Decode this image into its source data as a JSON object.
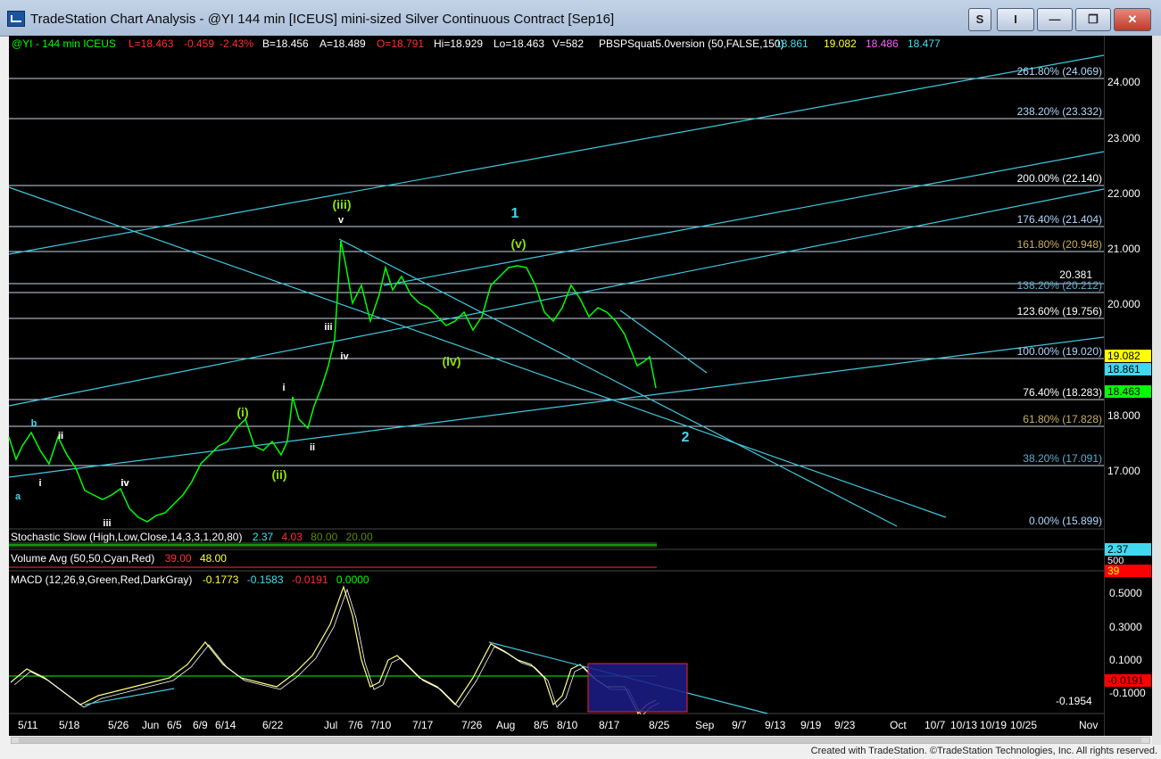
{
  "window": {
    "title": "TradeStation Chart Analysis - @YI 144 min [ICEUS] mini-sized Silver Continuous Contract [Sep16]",
    "buttons": {
      "s": "S",
      "i": "I",
      "min": "—",
      "max": "❐",
      "close": "✕"
    }
  },
  "header": [
    {
      "t": "@YI - 144 min  ICEUS",
      "c": "#00ff00"
    },
    {
      "t": "L=18.463",
      "c": "#ff3030"
    },
    {
      "t": "-0.459",
      "c": "#ff3030"
    },
    {
      "t": "-2.43%",
      "c": "#ff3030"
    },
    {
      "t": "B=18.456",
      "c": "#ffffff"
    },
    {
      "t": "A=18.489",
      "c": "#ffffff"
    },
    {
      "t": "O=18.791",
      "c": "#ff3030"
    },
    {
      "t": "Hi=18.929",
      "c": "#ffffff"
    },
    {
      "t": "Lo=18.463",
      "c": "#ffffff"
    },
    {
      "t": "V=582",
      "c": "#ffffff"
    },
    {
      "t": "PBSPSquat5.0version (50,FALSE,150)",
      "c": "#ffffff"
    },
    {
      "t": "18.861",
      "c": "#40e0f0"
    },
    {
      "t": "19.082",
      "c": "#ffff40"
    },
    {
      "t": "18.486",
      "c": "#ff60ff"
    },
    {
      "t": "18.477",
      "c": "#40e0f0"
    }
  ],
  "price_axis": [
    "24.000",
    "23.000",
    "22.000",
    "21.000",
    "20.000",
    "18.000",
    "17.000"
  ],
  "price_badges": [
    {
      "t": "19.082",
      "bg": "#ffff00",
      "fg": "#000000"
    },
    {
      "t": "18.861",
      "bg": "#40d8f0",
      "fg": "#000000"
    },
    {
      "t": "18.463",
      "bg": "#00ff00",
      "fg": "#000000"
    }
  ],
  "fib_levels": [
    {
      "label": "261.80% (24.069)",
      "color": "#b0d8ff"
    },
    {
      "label": "238.20% (23.332)",
      "color": "#b0d8ff"
    },
    {
      "label": "200.00% (22.140)",
      "color": "#ffffff"
    },
    {
      "label": "176.40% (21.404)",
      "color": "#b0d8ff"
    },
    {
      "label": "161.80% (20.948)",
      "color": "#c8b060"
    },
    {
      "label": "138.20% (20.212)",
      "color": "#5aaed0"
    },
    {
      "label": "123.60% (19.756)",
      "color": "#ffffff"
    },
    {
      "label": "100.00% (19.020)",
      "color": "#b0d8ff"
    },
    {
      "label": "76.40% (18.283)",
      "color": "#ffffff"
    },
    {
      "label": "61.80% (17.828)",
      "color": "#c8b060"
    },
    {
      "label": "38.20% (17.091)",
      "color": "#5aaed0"
    },
    {
      "label": "0.00% (15.899)",
      "color": "#b0d8ff"
    }
  ],
  "level_extra": "20.381",
  "wave_labels": [
    "(iii)",
    "v",
    "1",
    "(v)",
    "(iv)",
    "(i)",
    "(ii)",
    "2",
    "i",
    "ii",
    "iii",
    "iv",
    "a",
    "b",
    "iii",
    "iv",
    "ii",
    "i",
    "iv",
    "ii"
  ],
  "stochastic": {
    "name": "Stochastic Slow (High,Low,Close,14,3,3,1,20,80)",
    "v1": "2.37",
    "v2": "4.03",
    "v3": "80.00",
    "v4": "20.00",
    "badge": "2.37"
  },
  "volume": {
    "name": "Volume Avg (50,50,Cyan,Red)",
    "v1": "39.00",
    "v2": "48.00",
    "badge": "39",
    "badge2": "500"
  },
  "macd": {
    "name": "MACD (12,26,9,Green,Red,DarkGray)",
    "v1": "-0.1773",
    "v2": "-0.1583",
    "v3": "-0.0191",
    "v4": "0.0000",
    "axis": [
      "0.5000",
      "0.3000",
      "0.1000",
      "-0.1000"
    ],
    "badge": "-0.0191",
    "low": "-0.1954"
  },
  "xaxis": [
    "5/11",
    "5/18",
    "5/26",
    "Jun",
    "6/5",
    "6/9",
    "6/14",
    "6/22",
    "Jul",
    "7/6",
    "7/10",
    "7/17",
    "7/26",
    "Aug",
    "8/5",
    "8/10",
    "8/17",
    "8/25",
    "Sep",
    "9/7",
    "9/13",
    "9/19",
    "9/23",
    "Oct",
    "10/7",
    "10/13",
    "10/19",
    "10/25",
    "Nov"
  ],
  "footer": "Created with TradeStation. ©TradeStation Technologies, Inc. All rights reserved.",
  "colors": {
    "price": "#00ff00",
    "channel": "#40c8e0",
    "wave_green": "#8ee000",
    "wave_cyan": "#40d8f0"
  }
}
